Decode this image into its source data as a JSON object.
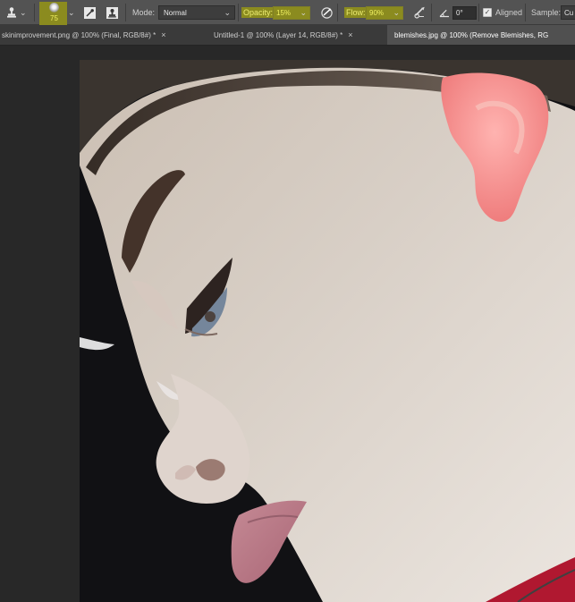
{
  "toolbar": {
    "mode_label": "Mode:",
    "mode_value": "Normal",
    "opacity_label": "Opacity:",
    "opacity_value": "15%",
    "flow_label": "Flow:",
    "flow_value": "90%",
    "angle_value": "0°",
    "aligned_label": "Aligned",
    "sample_label": "Sample:",
    "sample_value": "Cu",
    "brush_size": "75",
    "icons": {
      "tool": "clone-stamp-icon",
      "brush": "brush-preset-icon",
      "settings": "brush-settings-icon",
      "clone_source": "clone-source-icon",
      "pressure_opacity": "pressure-opacity-icon",
      "airbrush": "airbrush-icon",
      "angle": "angle-icon",
      "aligned_check": "checkbox-icon"
    },
    "accent_color": "#8b8b1f"
  },
  "tabs": [
    {
      "label": "skinimprovement.png @ 100% (Final, RGB/8#) *",
      "close": "×"
    },
    {
      "label": "Untitled-1 @ 100% (Layer 14, RGB/8#) *",
      "close": "×"
    },
    {
      "label": "blemishes.jpg @ 100% (Remove Blemishes, RG"
    }
  ],
  "canvas": {
    "content": "portrait-photo"
  }
}
